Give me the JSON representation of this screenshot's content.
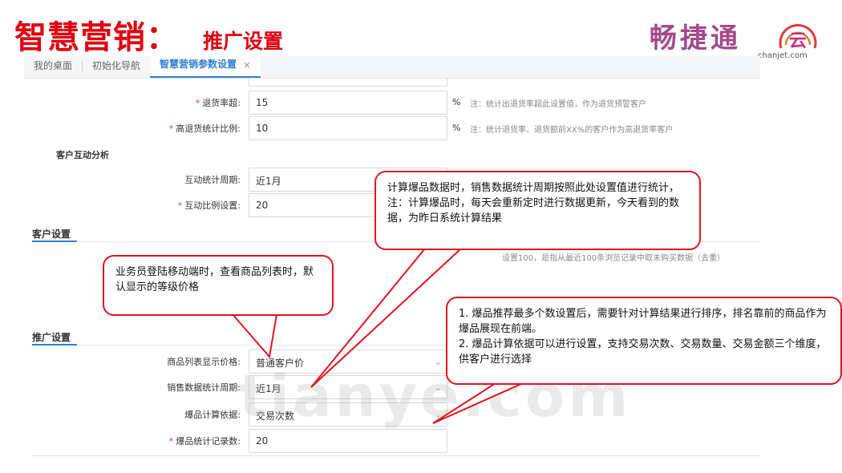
{
  "slide": {
    "title": "智慧营销：",
    "subtitle": "推广设置"
  },
  "logo": {
    "text": "畅捷通",
    "circle_char": "云",
    "domain": "chanjet.com"
  },
  "tabs": [
    {
      "label": "我的桌面"
    },
    {
      "label": "初始化导航"
    },
    {
      "label": "智慧营销参数设置",
      "close": "×"
    }
  ],
  "rows": {
    "return_rate": {
      "label": "退货率超:",
      "value": "15",
      "unit": "%",
      "note": "注：统计出退货率超此设置值，作为退货预警客户"
    },
    "high_return": {
      "label": "高退货统计比例:",
      "value": "10",
      "unit": "%",
      "note": "注：统计退货率、退货额前XX%的客户作为高退货率客户"
    },
    "interaction_period": {
      "label": "互动统计周期:",
      "value": "近1月"
    },
    "interaction_ratio": {
      "label": "互动比例设置:",
      "value": "20"
    },
    "list_price": {
      "label": "商品列表显示价格:",
      "value": "普通客户价"
    },
    "sales_period": {
      "label": "销售数据统计周期:",
      "value": "近1月"
    },
    "hot_basis": {
      "label": "爆品计算依据:",
      "value": "交易次数"
    },
    "hot_count": {
      "label": "爆品统计记录数:",
      "value": "20"
    }
  },
  "groups": {
    "customer_interaction": "客户互动分析",
    "customer_settings": "客户设置",
    "promotion_settings": "推广设置"
  },
  "hidden_note": "设置100，是指从最近100条浏览记录中取未购买数据（去重）",
  "watermark": "tianye.com",
  "callouts": {
    "c1": "业务员登陆移动端时，查看商品列表时，默认显示的等级价格",
    "c2": "计算爆品数据时，销售数据统计周期按照此处设置值进行统计，注：计算爆品时，每天会重新定时进行数据更新，今天看到的数据，为昨日系统计算结果",
    "c3_line1": "1. 爆品推荐最多个数设置后，需要针对计算结果进行排序，排名靠前的商品作为爆品展现在前端。",
    "c3_line2": "2. 爆品计算依据可以进行设置，支持交易次数、交易数量、交易金额三个维度，供客户进行选择"
  },
  "required_mark": "*",
  "chevron": "⌄",
  "colors": {
    "title_red": "#e00010",
    "accent_blue": "#2f7fd8",
    "callout_border": "#e0141e"
  }
}
